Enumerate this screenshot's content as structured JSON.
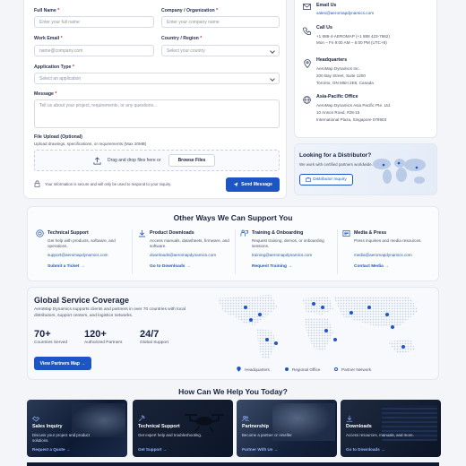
{
  "form": {
    "full_name_label": "Full Name",
    "full_name_placeholder": "Enter your full name",
    "company_label": "Company / Organization",
    "company_placeholder": "Enter your company name",
    "email_label": "Work Email",
    "email_placeholder": "name@company.com",
    "country_label": "Country / Region",
    "country_placeholder": "Select your country",
    "app_type_label": "Application Type",
    "app_type_placeholder": "Select an application",
    "message_label": "Message",
    "message_placeholder": "Tell us about your project, requirements, or any questions...",
    "upload_label": "File Upload (Optional)",
    "upload_hint": "Upload drawings, specifications, or requirements (Max 20MB)",
    "drop_text": "Drag and drop files here or",
    "browse_label": "Browse Files",
    "secure_note": "Your information is secure and will only be used to respond to your inquiry.",
    "send_label": "Send Message",
    "required_mark": "*"
  },
  "contact": {
    "email_title": "Email Us",
    "email_value": "sales@aeromapdynamics.com",
    "call_title": "Call Us",
    "call_value": "+1 888-4-AEROMAP  (+1 888 423-7662)",
    "call_hours": "Mon – Fri 9:00 AM – 6:00 PM (UTC+8)",
    "hq_title": "Headquarters",
    "hq_line1": "AeroMap Dynamics Inc.",
    "hq_line2": "200 Bay Street, Suite 1200",
    "hq_line3": "Toronto, ON M5H 2E6, Canada",
    "ap_title": "Asia-Pacific Office",
    "ap_line1": "AeroMap Dynamics Asia Pacific Pte. Ltd.",
    "ap_line2": "10 Anson Road, #28-15",
    "ap_line3": "International Plaza, Singapore 079903"
  },
  "distributor": {
    "title": "Looking for a Distributor?",
    "desc": "We work with certified partners worldwide.",
    "button": "Distributor Inquiry"
  },
  "other_ways": {
    "heading": "Other Ways We Can Support You",
    "cards": [
      {
        "title": "Technical Support",
        "desc": "Get help with products, software, and operations.",
        "email": "support@aeromapdynamics.com",
        "link": "Submit a Ticket →"
      },
      {
        "title": "Product Downloads",
        "desc": "Access manuals, datasheets, firmware, and software.",
        "email": "downloads@aeromapdynamics.com",
        "link": "Go to Downloads →"
      },
      {
        "title": "Training & Onboarding",
        "desc": "Request training, demos, or onboarding sessions.",
        "email": "training@aeromapdynamics.com",
        "link": "Request Training →"
      },
      {
        "title": "Media & Press",
        "desc": "Press inquiries and media resources.",
        "email": "media@aeromapdynamics.com",
        "link": "Contact Media →"
      }
    ]
  },
  "coverage": {
    "heading": "Global Service Coverage",
    "desc": "AeroMap Dynamics supports clients and partners in over 70 countries with local distributors, support centers, and logistics networks.",
    "stats": [
      {
        "value": "70+",
        "label": "Countries Served"
      },
      {
        "value": "120+",
        "label": "Authorized Partners"
      },
      {
        "value": "24/7",
        "label": "Global Support"
      }
    ],
    "button": "View Partners Map →",
    "legend": [
      "Headquarters",
      "Regional Office",
      "Partner Network"
    ]
  },
  "help": {
    "heading": "How Can We Help You Today?",
    "tiles": [
      {
        "title": "Sales Inquiry",
        "desc": "Discuss your project and product solutions.",
        "link": "Request a Quote →"
      },
      {
        "title": "Technical Support",
        "desc": "Get expert help and troubleshooting.",
        "link": "Get Support →"
      },
      {
        "title": "Partnership",
        "desc": "Become a partner or reseller.",
        "link": "Partner With Us →"
      },
      {
        "title": "Downloads",
        "desc": "Access resources, manuals, and more.",
        "link": "Go to Downloads →"
      }
    ]
  },
  "colors": {
    "accent": "#1d56c4",
    "dark": "#0e1a33"
  }
}
